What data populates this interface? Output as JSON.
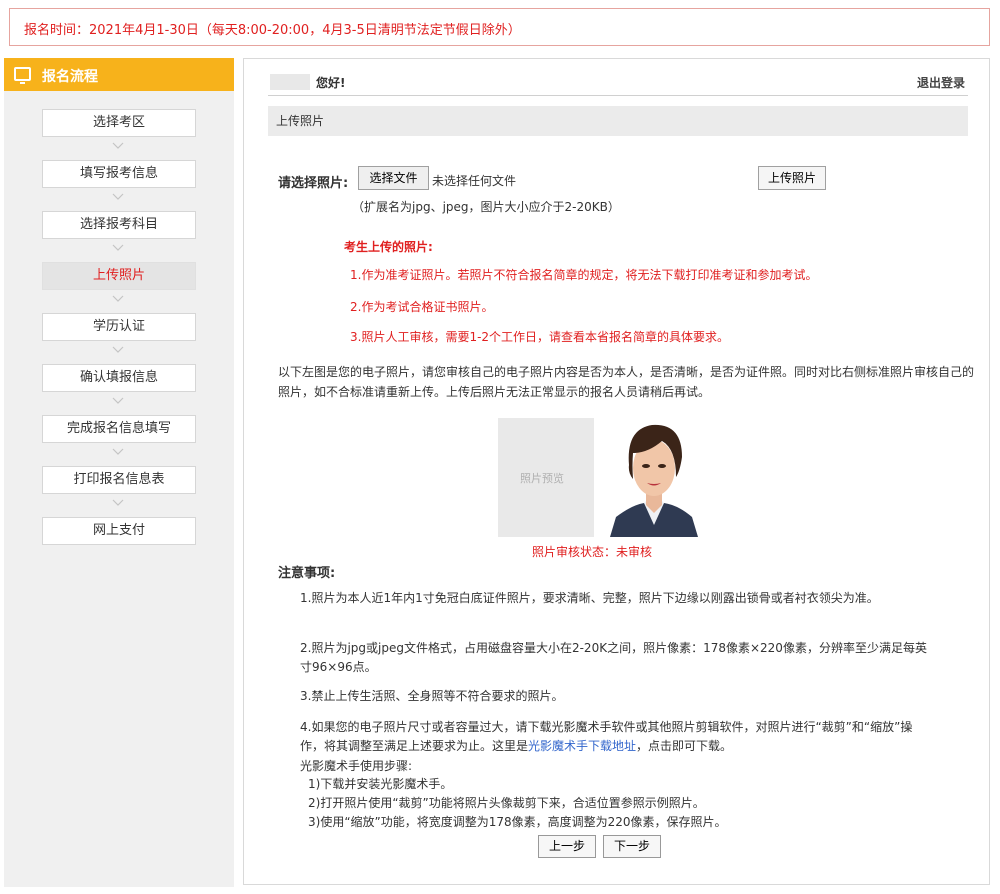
{
  "notice": "报名时间：2021年4月1-30日（每天8:00-20:00，4月3-5日清明节法定节假日除外）",
  "sidebar": {
    "title": "报名流程",
    "steps": [
      {
        "label": "选择考区",
        "active": false
      },
      {
        "label": "填写报考信息",
        "active": false
      },
      {
        "label": "选择报考科目",
        "active": false
      },
      {
        "label": "上传照片",
        "active": true
      },
      {
        "label": "学历认证",
        "active": false
      },
      {
        "label": "确认填报信息",
        "active": false
      },
      {
        "label": "完成报名信息填写",
        "active": false
      },
      {
        "label": "打印报名信息表",
        "active": false
      },
      {
        "label": "网上支付",
        "active": false
      }
    ]
  },
  "header": {
    "greeting": "您好!",
    "logout": "退出登录",
    "section_title": "上传照片"
  },
  "upload": {
    "select_label": "请选择照片:",
    "choose_file": "选择文件",
    "no_file": "未选择任何文件",
    "upload_button": "上传照片",
    "ext_note": "（扩展名为jpg、jpeg，图片大小应介于2-20KB）"
  },
  "uploaded_photo": {
    "heading": "考生上传的照片:",
    "lines": [
      "1.作为准考证照片。若照片不符合报名简章的规定，将无法下载打印准考证和参加考试。",
      "2.作为考试合格证书照片。",
      "3.照片人工审核，需要1-2个工作日，请查看本省报名简章的具体要求。"
    ]
  },
  "instruction": "以下左图是您的电子照片，请您审核自己的电子照片内容是否为本人，是否清晰，是否为证件照。同时对比右侧标准照片审核自己的照片，如不合标准请重新上传。上传后照片无法正常显示的报名人员请稍后再试。",
  "preview": {
    "placeholder": "照片预览",
    "status": "照片审核状态：未审核"
  },
  "notes": {
    "title": "注意事项:",
    "n1": "1.照片为本人近1年内1寸免冠白底证件照片，要求清晰、完整，照片下边缘以刚露出锁骨或者衬衣领尖为准。",
    "n2": "2.照片为jpg或jpeg文件格式，占用磁盘容量大小在2-20K之间，照片像素：178像素×220像素，分辨率至少满足每英寸96×96点。",
    "n3": "3.禁止上传生活照、全身照等不符合要求的照片。",
    "n4_before": "4.如果您的电子照片尺寸或者容量过大，请下载光影魔术手软件或其他照片剪辑软件，对照片进行“裁剪”和“缩放”操作，将其调整至满足上述要求为止。这里是",
    "n4_link": "光影魔术手下载地址",
    "n4_after": "，点击即可下载。",
    "usage_title": "光影魔术手使用步骤:",
    "usage": [
      "1)下载并安装光影魔术手。",
      "2)打开照片使用“裁剪”功能将照片头像裁剪下来，合适位置参照示例照片。",
      "3)使用“缩放”功能，将宽度调整为178像素，高度调整为220像素，保存照片。"
    ]
  },
  "buttons": {
    "prev": "上一步",
    "next": "下一步"
  },
  "colors": {
    "accent": "#f7b21b",
    "alert_red": "#e02020",
    "link_blue": "#3366cc"
  }
}
